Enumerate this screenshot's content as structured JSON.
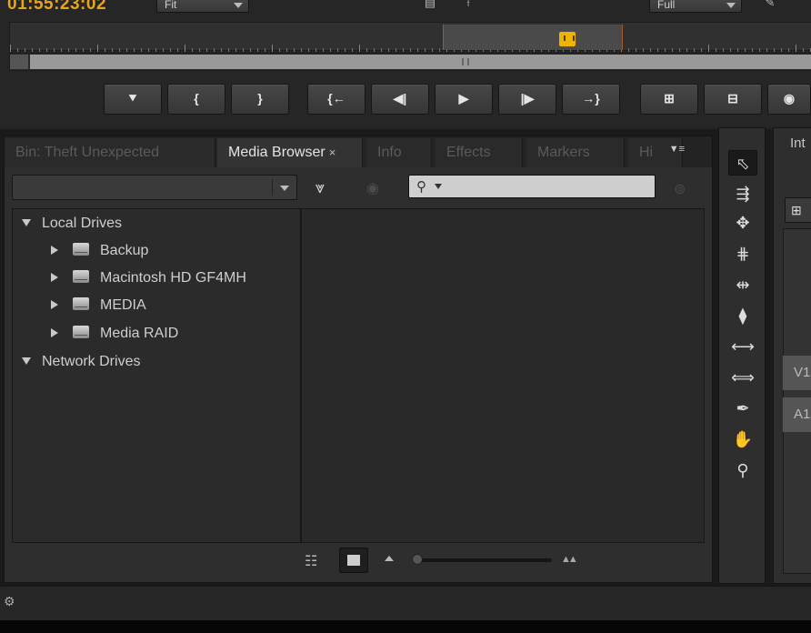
{
  "monitor": {
    "timecode": "01:55:23:02",
    "fit_label": "Fit",
    "quality_label": "Full"
  },
  "transport": {
    "buttons": [
      {
        "name": "add-marker-button",
        "glyph": "⯆"
      },
      {
        "name": "mark-in-button",
        "glyph": "{"
      },
      {
        "name": "mark-out-button",
        "glyph": "}"
      },
      {
        "name": "go-to-in-button",
        "glyph": "{←"
      },
      {
        "name": "step-back-button",
        "glyph": "◀|"
      },
      {
        "name": "play-button",
        "glyph": "▶"
      },
      {
        "name": "step-forward-button",
        "glyph": "|▶"
      },
      {
        "name": "go-to-out-button",
        "glyph": "→}"
      },
      {
        "name": "insert-button",
        "glyph": "⊞"
      },
      {
        "name": "overwrite-button",
        "glyph": "⊟"
      },
      {
        "name": "export-frame-button",
        "glyph": "◉"
      }
    ]
  },
  "panel": {
    "tabs": [
      {
        "label": "Bin: Theft Unexpected",
        "active": false
      },
      {
        "label": "Media Browser",
        "active": true,
        "close": "×"
      },
      {
        "label": "Info",
        "active": false
      },
      {
        "label": "Effects",
        "active": false
      },
      {
        "label": "Markers",
        "active": false
      },
      {
        "label": "Hi",
        "active": false
      }
    ],
    "menu_glyph": "▼≡",
    "path_value": "",
    "search_value": ""
  },
  "tree": {
    "local_drives_label": "Local Drives",
    "drives": [
      {
        "label": "Backup"
      },
      {
        "label": "Macintosh HD GF4MH"
      },
      {
        "label": "MEDIA"
      },
      {
        "label": "Media RAID"
      }
    ],
    "network_drives_label": "Network Drives"
  },
  "browser": {
    "thumbnail_zoom": 0.0
  },
  "timeline": {
    "tab_label": "Int",
    "video_track": "V1",
    "audio_track": "A1"
  },
  "colors": {
    "timecode": "#e8a41c",
    "playhead": "#f0b400"
  }
}
